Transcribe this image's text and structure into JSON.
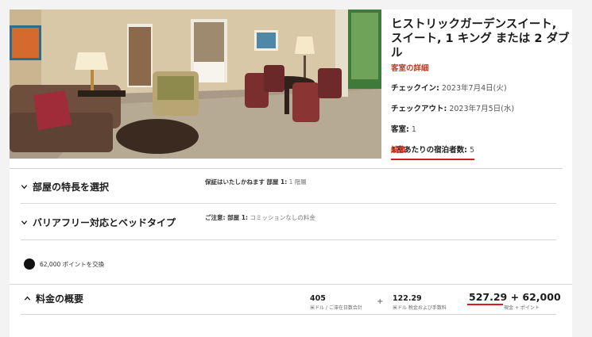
{
  "room": {
    "title": "ヒストリックガーデンスイート, スイート, 1 キング または 2 ダブル",
    "details_link": "客室の詳細",
    "checkin_label": "チェックイン:",
    "checkin_value": "2023年7月4日(火)",
    "checkout_label": "チェックアウト:",
    "checkout_value": "2023年7月5日(水)",
    "rooms_label": "客室:",
    "rooms_value": "1",
    "guests_label": "1室あたりの宿泊者数:",
    "guests_value": "5",
    "edit_link": "編集"
  },
  "sections": {
    "room_features": {
      "title": "部屋の特長を選択",
      "note_bold": "保証はいたしかねます",
      "note_label": "部屋 1:",
      "note_value": "1 階層"
    },
    "accessibility": {
      "title": "バリアフリー対応とベッドタイプ",
      "note_label": "ご注意: 部屋 1:",
      "note_value": "コミッションなしの料金"
    }
  },
  "points_exchange": "62,000 ポイントを交換",
  "summary": {
    "title": "料金の概要",
    "base_amount": "405",
    "base_sub": "米ドル / ご滞在日数合計",
    "plus": "+",
    "tax_amount": "122.29",
    "tax_sub": "米ドル 税金および手数料",
    "total": "527.29 + 62,000",
    "total_sub": "現金 + ポイント"
  },
  "colors": {
    "accent_red": "#c2391d",
    "underline_red": "#d21e1e",
    "text": "#1c1c1c"
  },
  "icons": {
    "chevron_down": "chevron-down-icon",
    "chevron_up": "chevron-up-icon",
    "points": "points-dot-icon"
  }
}
